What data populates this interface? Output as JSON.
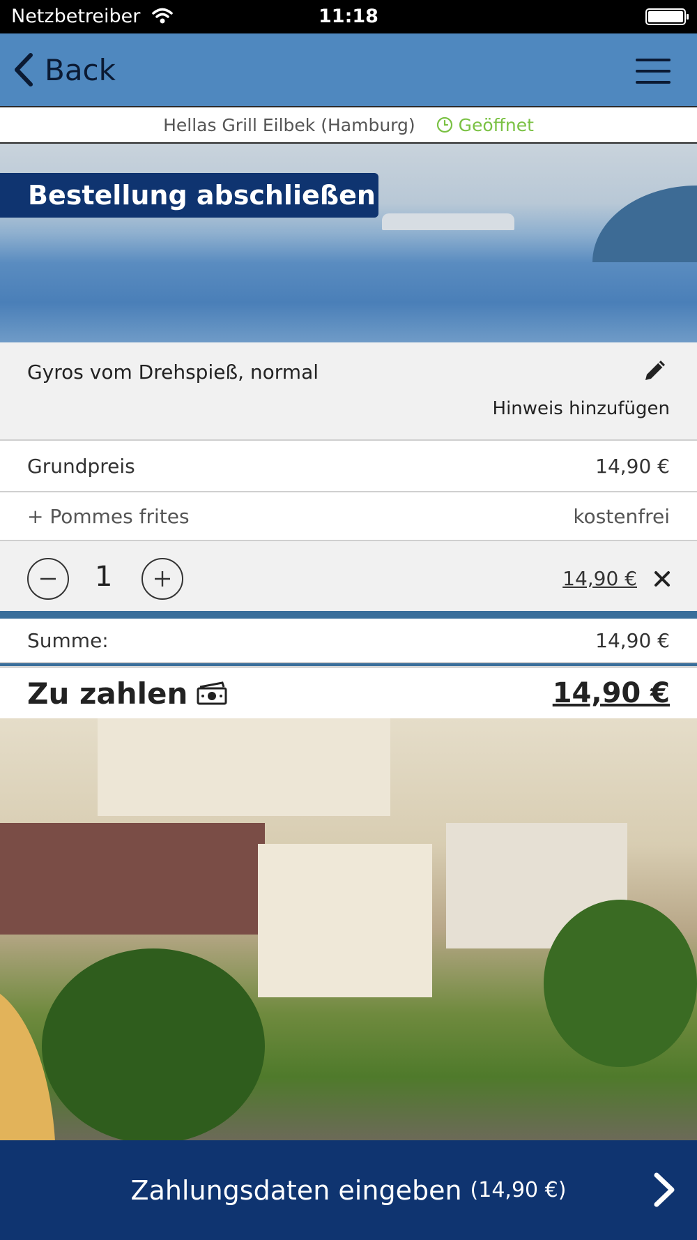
{
  "status_bar": {
    "carrier": "Netzbetreiber",
    "time": "11:18"
  },
  "nav": {
    "back_label": "Back"
  },
  "restaurant": {
    "name": "Hellas Grill Eilbek (Hamburg)",
    "status": "Geöffnet",
    "status_color": "#7ac143"
  },
  "order": {
    "title": "Bestellung abschließen",
    "item_name": "Gyros vom Drehspieß, normal",
    "note_label": "Hinweis hinzufügen",
    "base_label": "Grundpreis",
    "base_price": "14,90 €",
    "extra_label": "+ Pommes frites",
    "extra_price": "kostenfrei",
    "quantity": "1",
    "line_total": "14,90 €"
  },
  "totals": {
    "sum_label": "Summe:",
    "sum_value": "14,90 €",
    "pay_label": "Zu zahlen",
    "pay_value": "14,90 €"
  },
  "cta": {
    "label": "Zahlungsdaten eingeben",
    "amount": "(14,90 €)"
  },
  "colors": {
    "nav": "#4f88bf",
    "brand_dark": "#0f3470"
  },
  "icons": [
    "wifi-icon",
    "battery-icon",
    "back-chevron-icon",
    "hamburger-menu-icon",
    "clock-icon",
    "pencil-icon",
    "minus-icon",
    "plus-icon",
    "close-icon",
    "cash-icon",
    "chevron-right-icon"
  ]
}
